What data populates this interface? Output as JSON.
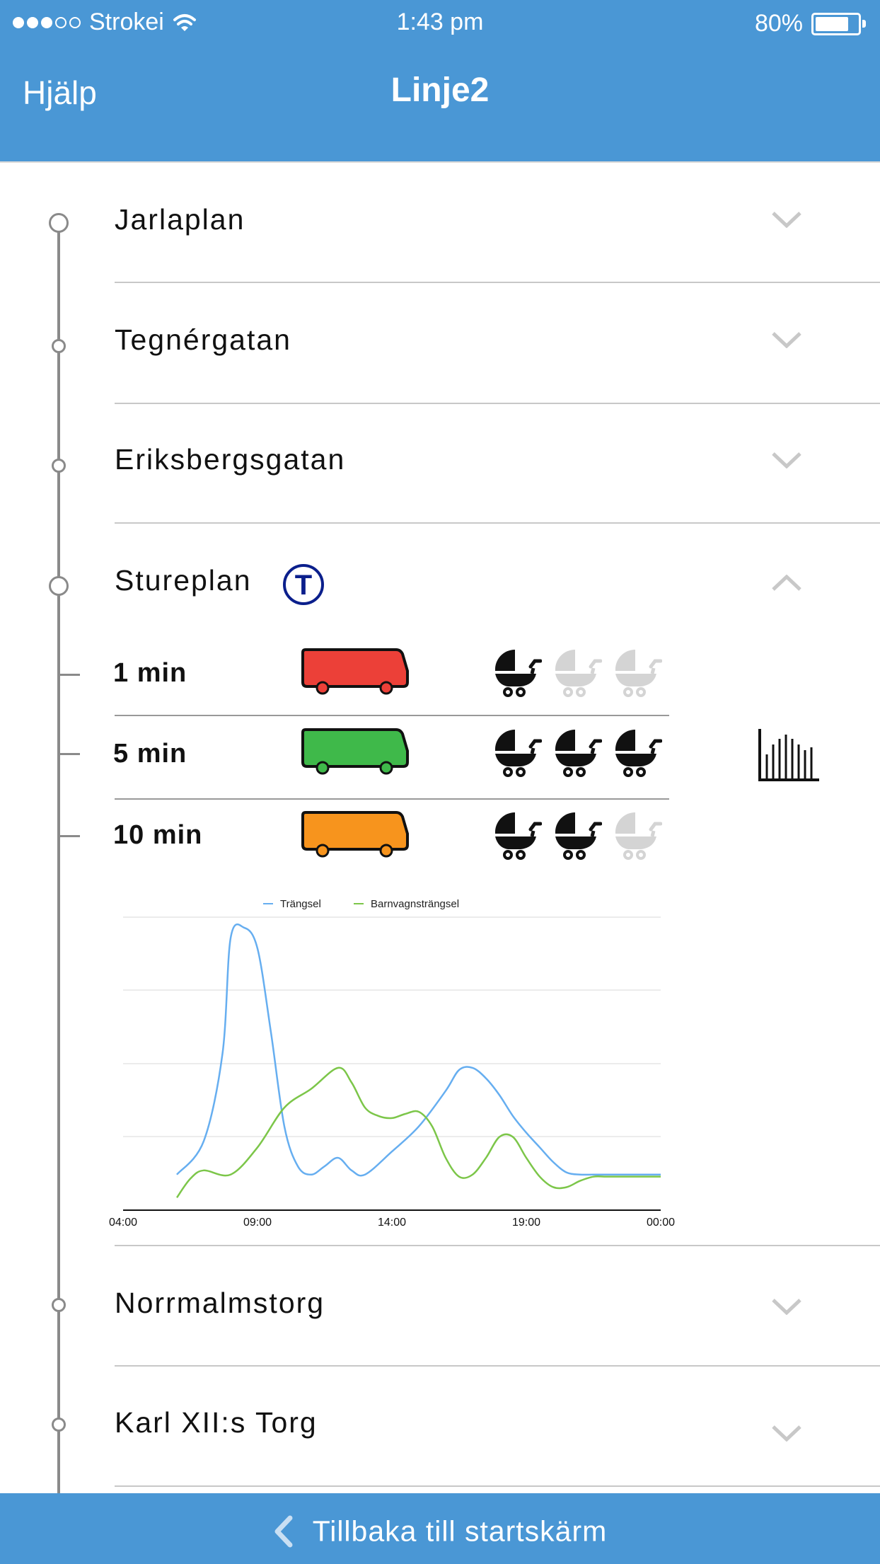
{
  "status_bar": {
    "carrier": "Strokei",
    "time": "1:43 pm",
    "battery": "80%",
    "battery_level": 0.8
  },
  "nav": {
    "help_label": "Hjälp",
    "title": "Linje2"
  },
  "stops": [
    {
      "name": "Jarlaplan",
      "expanded": false
    },
    {
      "name": "Tegnérgatan",
      "expanded": false
    },
    {
      "name": "Eriksbergsgatan",
      "expanded": false
    },
    {
      "name": "Stureplan",
      "expanded": true,
      "badge": "T"
    },
    {
      "name": "Norrmalmstorg",
      "expanded": false
    },
    {
      "name": "Karl XII:s Torg",
      "expanded": false
    }
  ],
  "departures": [
    {
      "time": "1 min",
      "bus_color": "#ec4038",
      "prams_available": 1,
      "prams_total": 3
    },
    {
      "time": "5 min",
      "bus_color": "#3fb94a",
      "prams_available": 3,
      "prams_total": 3
    },
    {
      "time": "10 min",
      "bus_color": "#f7941d",
      "prams_available": 2,
      "prams_total": 3
    }
  ],
  "chart_data": {
    "type": "line",
    "x_ticks": [
      "04:00",
      "09:00",
      "14:00",
      "19:00",
      "00:00"
    ],
    "xlim": [
      "04:00",
      "00:00"
    ],
    "grid": true,
    "legend_position": "top-center",
    "series": [
      {
        "name": "Trängsel",
        "color": "#66aef0",
        "x": [
          6.0,
          7.0,
          7.7,
          8.0,
          8.5,
          9.0,
          9.5,
          10.0,
          10.5,
          11.0,
          11.5,
          12.0,
          12.5,
          13.0,
          14.0,
          15.0,
          16.0,
          16.5,
          17.0,
          17.5,
          18.0,
          18.5,
          19.0,
          19.5,
          20.0,
          20.5,
          21.0,
          21.5,
          22.0,
          23.0,
          24.0
        ],
        "y": [
          0.2,
          1.8,
          6.0,
          11.5,
          12.0,
          11.0,
          7.0,
          2.5,
          0.6,
          0.2,
          0.6,
          1.0,
          0.4,
          0.2,
          1.3,
          2.5,
          4.2,
          5.2,
          5.3,
          4.8,
          4.0,
          3.0,
          2.2,
          1.5,
          0.8,
          0.3,
          0.2,
          0.2,
          0.2,
          0.2,
          0.2
        ]
      },
      {
        "name": "Barnvagnsträngsel",
        "color": "#7cc649",
        "x": [
          6.0,
          6.5,
          7.0,
          8.0,
          9.0,
          10.0,
          11.0,
          12.0,
          12.5,
          13.0,
          13.5,
          14.0,
          14.5,
          15.0,
          15.5,
          16.0,
          16.5,
          17.0,
          17.5,
          18.0,
          18.5,
          19.0,
          19.5,
          20.0,
          20.5,
          21.0,
          21.5,
          22.0,
          23.0,
          24.0
        ],
        "y": [
          -0.9,
          0.0,
          0.4,
          0.2,
          1.5,
          3.4,
          4.3,
          5.3,
          4.6,
          3.4,
          3.0,
          2.9,
          3.1,
          3.2,
          2.5,
          1.0,
          0.1,
          0.2,
          1.0,
          2.0,
          2.0,
          1.0,
          0.1,
          -0.4,
          -0.4,
          -0.1,
          0.1,
          0.1,
          0.1,
          0.1
        ]
      }
    ]
  },
  "footer": {
    "back_label": "Tillbaka till startskärm"
  }
}
